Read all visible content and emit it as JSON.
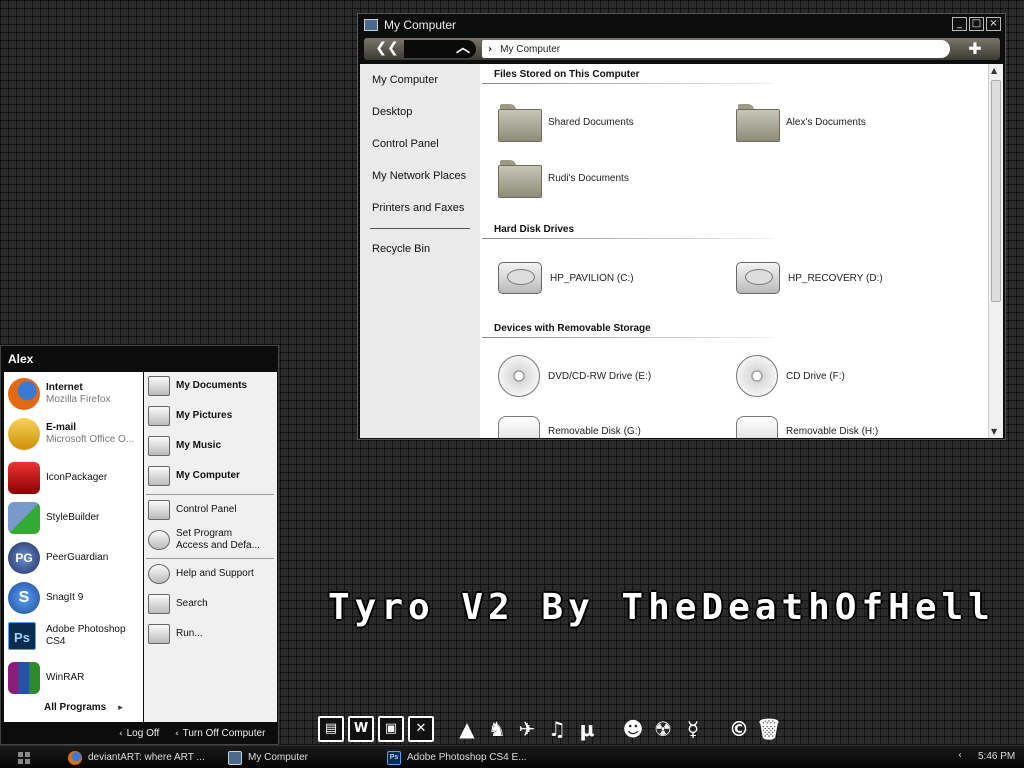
{
  "window": {
    "title": "My Computer",
    "controls": {
      "minimize": "_",
      "maximize": "□",
      "close": "×"
    },
    "address": "My Computer",
    "sidebar": [
      "My Computer",
      "Desktop",
      "Control Panel",
      "My Network Places",
      "Printers and Faxes",
      "Recycle Bin"
    ],
    "sections": {
      "files": {
        "heading": "Files Stored on This Computer",
        "items": [
          "Shared Documents",
          "Alex's Documents",
          "Rudi's Documents"
        ]
      },
      "drives": {
        "heading": "Hard Disk Drives",
        "items": [
          "HP_PAVILION (C:)",
          "HP_RECOVERY (D:)"
        ]
      },
      "removable": {
        "heading": "Devices with Removable Storage",
        "items": [
          "DVD/CD-RW Drive (E:)",
          "CD Drive (F:)",
          "Removable Disk (G:)",
          "Removable Disk (H:)"
        ]
      }
    }
  },
  "start_menu": {
    "user": "Alex",
    "pinned": [
      {
        "title": "Internet",
        "subtitle": "Mozilla Firefox",
        "icon": "firefox-icon"
      },
      {
        "title": "E-mail",
        "subtitle": "Microsoft Office O...",
        "icon": "outlook-icon"
      }
    ],
    "recent": [
      {
        "title": "IconPackager",
        "icon": "iconpackager-icon"
      },
      {
        "title": "StyleBuilder",
        "icon": "stylebuilder-icon"
      },
      {
        "title": "PeerGuardian",
        "icon": "peerguardian-icon",
        "glyph": "PG"
      },
      {
        "title": "SnagIt 9",
        "icon": "snagit-icon",
        "glyph": "S"
      },
      {
        "title": "Adobe Photoshop",
        "title2": "CS4",
        "icon": "photoshop-icon",
        "glyph": "Ps"
      },
      {
        "title": "WinRAR",
        "icon": "winrar-icon"
      }
    ],
    "all_programs": "All Programs",
    "all_programs_arrow": "▸",
    "right": {
      "my_documents": "My Documents",
      "my_pictures": "My Pictures",
      "my_music": "My Music",
      "my_computer": "My Computer",
      "control_panel": "Control Panel",
      "set_program_1": "Set Program",
      "set_program_2": "Access and Defa...",
      "help": "Help and Support",
      "search": "Search",
      "run": "Run..."
    },
    "log_off": "Log Off",
    "turn_off": "Turn Off Computer",
    "small_arrow": "‹"
  },
  "watermark": "Tyro V2 By TheDeathOfHell",
  "dock": {
    "icons": [
      {
        "name": "dock-document-icon",
        "glyph": "▤"
      },
      {
        "name": "dock-word-icon",
        "glyph": "W"
      },
      {
        "name": "dock-picture-icon",
        "glyph": "▣"
      },
      {
        "name": "dock-excel-icon",
        "glyph": "✕"
      },
      {
        "name": "dock-vlc-icon",
        "glyph": "▲"
      },
      {
        "name": "dock-fox-icon",
        "glyph": "♞"
      },
      {
        "name": "dock-satellite-icon",
        "glyph": "✈"
      },
      {
        "name": "dock-music-icon",
        "glyph": "♫"
      },
      {
        "name": "dock-utorrent-icon",
        "glyph": "μ"
      },
      {
        "name": "dock-users-icon",
        "glyph": "☻"
      },
      {
        "name": "dock-bomb-icon",
        "glyph": "☢"
      },
      {
        "name": "dock-runner-icon",
        "glyph": "☿"
      },
      {
        "name": "dock-ccleaner-icon",
        "glyph": "©"
      },
      {
        "name": "dock-trash-icon",
        "glyph": "🗑"
      }
    ]
  },
  "taskbar": {
    "tasks": [
      {
        "label": "deviantART: where ART ...",
        "icon": "firefox-icon"
      },
      {
        "label": "My Computer",
        "icon": "computer-icon"
      },
      {
        "label": "Adobe Photoshop CS4 E...",
        "icon": "photoshop-icon",
        "glyph": "Ps"
      }
    ],
    "tray_arrow": "‹",
    "clock": "5:46 PM"
  },
  "nav": {
    "back": "❮❮",
    "up": "︿",
    "chevron": "›",
    "plus": "✚"
  }
}
